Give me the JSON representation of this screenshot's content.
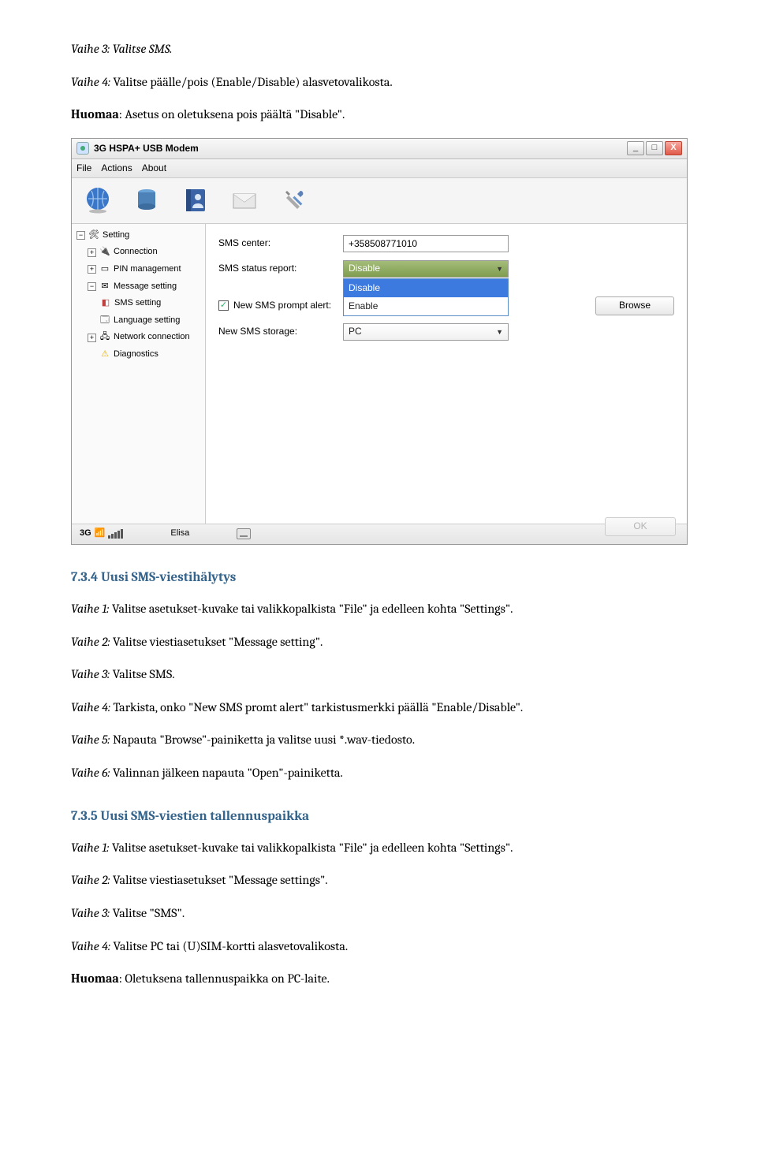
{
  "doc": {
    "step3_prefix": "Vaihe 3:",
    "step3_text": " Valitse SMS.",
    "step4_prefix": "Vaihe 4:",
    "step4_text": " Valitse päälle/pois (Enable/Disable) alasvetovalikosta.",
    "note_prefix": "Huomaa",
    "note_text": ": Asetus on oletuksena pois päältä \"Disable\".",
    "sec_734": "7.3.4 Uusi SMS-viestihälytys",
    "s734_1a": "Vaihe 1:",
    "s734_1b": " Valitse asetukset-kuvake tai valikkopalkista \"File\" ja edelleen kohta \"Settings\".",
    "s734_2a": "Vaihe 2:",
    "s734_2b": " Valitse viestiasetukset \"Message setting\".",
    "s734_3a": "Vaihe 3:",
    "s734_3b": " Valitse SMS.",
    "s734_4a": "Vaihe 4:",
    "s734_4b": " Tarkista, onko \"New SMS promt alert\" tarkistusmerkki päällä \"Enable/Disable\".",
    "s734_5a": "Vaihe 5:",
    "s734_5b": " Napauta \"Browse\"-painiketta ja valitse uusi *.wav-tiedosto.",
    "s734_6a": "Vaihe 6:",
    "s734_6b": " Valinnan jälkeen napauta \"Open\"-painiketta.",
    "sec_735": "7.3.5 Uusi SMS-viestien tallennuspaikka",
    "s735_1a": "Vaihe 1:",
    "s735_1b": " Valitse asetukset-kuvake tai valikkopalkista \"File\" ja edelleen kohta \"Settings\".",
    "s735_2a": "Vaihe 2:",
    "s735_2b": " Valitse viestiasetukset \"Message settings\".",
    "s735_3a": "Vaihe 3:",
    "s735_3b": " Valitse \"SMS\".",
    "s735_4a": "Vaihe 4:",
    "s735_4b": " Valitse PC tai (U)SIM-kortti alasvetovalikosta.",
    "note2_prefix": "Huomaa",
    "note2_text": ": Oletuksena tallennuspaikka on PC-laite."
  },
  "app": {
    "title": "3G HSPA+ USB Modem",
    "menu": {
      "file": "File",
      "actions": "Actions",
      "about": "About"
    },
    "tree": {
      "setting": "Setting",
      "connection": "Connection",
      "pin": "PIN management",
      "msg": "Message setting",
      "sms": "SMS setting",
      "lang": "Language setting",
      "net": "Network connection",
      "diag": "Diagnostics"
    },
    "form": {
      "sms_center_lbl": "SMS center:",
      "sms_center_val": "+358508771010",
      "status_lbl": "SMS status report:",
      "status_val": "Disable",
      "dd_disable": "Disable",
      "dd_enable": "Enable",
      "alert_lbl": "New SMS prompt alert:",
      "storage_lbl": "New  SMS storage:",
      "storage_val": "PC",
      "browse": "Browse",
      "ok": "OK"
    },
    "status": {
      "sig": "3G",
      "carrier": "Elisa"
    }
  }
}
